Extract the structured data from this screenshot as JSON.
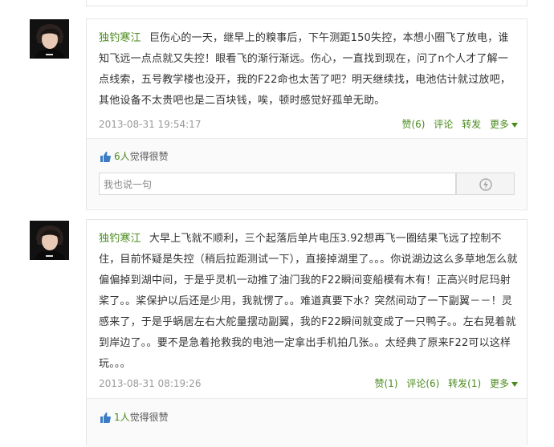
{
  "comments": [
    {
      "author": "独钓寒江",
      "text": "巨伤心的一天，继早上的糗事后，下午测距150失控，本想小圈飞了放电，谁知飞远一点点就又失控！眼看飞的渐行渐远。伤心，一直找到现在，问了n个人才了解一点线索，五号教学楼也没开，我的F22命也太苦了吧？明天继续找，电池估计就过放吧，其他设备不太贵吧也是二百块钱，唉，顿时感觉好孤单无助。",
      "date": "2013-08-31 19:54:17",
      "actions": {
        "like": "赞(6)",
        "comment": "评论",
        "forward": "转发",
        "more": "更多"
      },
      "likes_count": "6人",
      "likes_suffix": "觉得很赞",
      "reply_placeholder": "我也说一句"
    },
    {
      "author": "独钓寒江",
      "text": "大早上飞就不顺利，三个起落后单片电压3.92想再飞一圈结果飞远了控制不住，目前怀疑是失控（稍后拉距测试一下），直接掉湖里了。。。你说湖边这么多草地怎么就偏偏掉到湖中间，于是乎灵机一动推了油门我的F22瞬间变船模有木有！正高兴时尼玛射桨了。。桨保护以后还是少用，我就愣了。。难道真要下水？突然间动了一下副翼－－！灵感来了，于是乎蜗居左右大舵量摆动副翼，我的F22瞬间就变成了一只鸭子。。左右晃着就到岸边了。。要不是急着抢救我的电池一定拿出手机拍几张。。太经典了原来F22可以这样玩。。。",
      "date": "2013-08-31 08:19:26",
      "actions": {
        "like": "赞(1)",
        "comment": "评论(6)",
        "forward": "转发(1)",
        "more": "更多"
      },
      "likes_count": "1人",
      "likes_suffix": "觉得很赞"
    }
  ],
  "colors": {
    "accent": "#4a8a1d",
    "date": "#9a9a9a",
    "border": "#e5e5e5"
  },
  "icons": {
    "avatar": "user-avatar",
    "thumb": "thumbs-up-icon",
    "send": "lightning-send-icon",
    "more": "chevron-down-icon"
  }
}
